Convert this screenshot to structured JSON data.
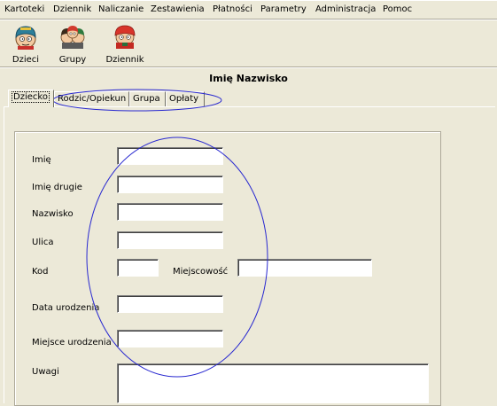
{
  "menu": {
    "items": [
      "Kartoteki",
      "Dziennik",
      "Naliczanie",
      "Zestawienia",
      "Płatności",
      "Parametry",
      "Administracja",
      "Pomoc"
    ]
  },
  "toolbar": {
    "buttons": [
      {
        "label": "Dzieci",
        "icon": "child-face-icon"
      },
      {
        "label": "Grupy",
        "icon": "group-faces-icon"
      },
      {
        "label": "Dziennik",
        "icon": "journal-character-icon"
      }
    ]
  },
  "record": {
    "title": "Imię Nazwisko"
  },
  "tabs": [
    {
      "label": "Dziecko",
      "active": true
    },
    {
      "label": "Rodzic/Opiekun",
      "active": false
    },
    {
      "label": "Grupa",
      "active": false
    },
    {
      "label": "Opłaty",
      "active": false
    }
  ],
  "form": {
    "labels": {
      "first_name": "Imię",
      "middle_name": "Imię drugie",
      "last_name": "Nazwisko",
      "street": "Ulica",
      "postal_code": "Kod",
      "city": "Miejscowość",
      "birth_date": "Data urodzenia",
      "birth_place": "Miejsce urodzenia",
      "notes": "Uwagi"
    },
    "values": {
      "first_name": "",
      "middle_name": "",
      "last_name": "",
      "street": "",
      "postal_code": "",
      "city": "",
      "birth_date": "",
      "birth_place": "",
      "notes": ""
    }
  },
  "colors": {
    "window_bg": "#ece9d8",
    "field_bg": "#ffffff",
    "annotation_ellipse": "#2828d0"
  }
}
